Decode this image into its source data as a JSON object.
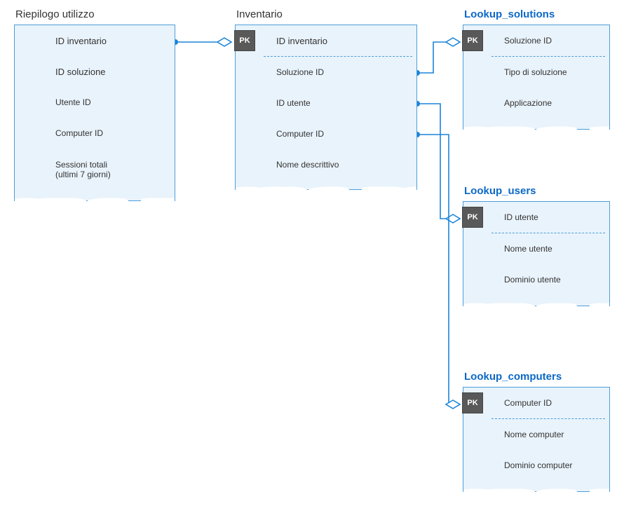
{
  "entities": {
    "usage_summary": {
      "title": "Riepilogo utilizzo",
      "title_blue": false,
      "fields": [
        {
          "label": "ID inventario"
        },
        {
          "label": "ID soluzione"
        },
        {
          "label": "Utente  ID"
        },
        {
          "label": "Computer ID"
        },
        {
          "label": "Sessioni totali\n  (ultimi 7 giorni)"
        }
      ]
    },
    "inventory": {
      "title": "Inventario",
      "title_blue": false,
      "pk": "PK",
      "fields": [
        {
          "label": "ID inventario",
          "pk": true
        },
        {
          "label": "Soluzione  ID"
        },
        {
          "label": "ID utente"
        },
        {
          "label": "Computer ID"
        },
        {
          "label": "Nome descrittivo"
        }
      ]
    },
    "lookup_solutions": {
      "title": "Lookup_solutions",
      "title_blue": true,
      "pk": "PK",
      "fields": [
        {
          "label": "Soluzione  ID",
          "pk": true
        },
        {
          "label": "Tipo di soluzione"
        },
        {
          "label": "Applicazione"
        }
      ]
    },
    "lookup_users": {
      "title": "Lookup_users",
      "title_blue": true,
      "pk": "PK",
      "fields": [
        {
          "label": "ID utente",
          "pk": true
        },
        {
          "label": "Nome utente"
        },
        {
          "label": "Dominio utente"
        }
      ]
    },
    "lookup_computers": {
      "title": "Lookup_computers",
      "title_blue": true,
      "pk": "PK",
      "fields": [
        {
          "label": "Computer ID",
          "pk": true
        },
        {
          "label": "Nome computer"
        },
        {
          "label": "Dominio computer"
        }
      ]
    }
  },
  "relations": [
    {
      "from": "usage_summary.ID inventario",
      "to": "inventory.ID inventario"
    },
    {
      "from": "inventory.Soluzione ID",
      "to": "lookup_solutions.Soluzione ID"
    },
    {
      "from": "inventory.ID utente",
      "to": "lookup_users.ID utente"
    },
    {
      "from": "inventory.Computer ID",
      "to": "lookup_computers.Computer ID"
    }
  ],
  "colors": {
    "box_bg": "#e9f3fb",
    "box_border": "#4c9ed9",
    "connector": "#1b84d8",
    "pk_badge": "#595959",
    "title_blue": "#0b68c6"
  }
}
